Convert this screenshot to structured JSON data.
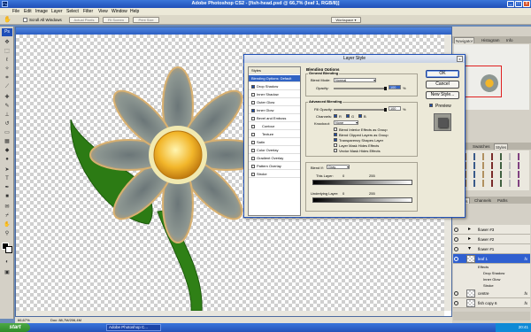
{
  "window": {
    "title": "Adobe Photoshop CS2 - [fish-head.psd @ 66,7% (leaf 1, RGB/8)]",
    "buttons": [
      "_",
      "□",
      "x"
    ]
  },
  "menu": [
    "File",
    "Edit",
    "Image",
    "Layer",
    "Select",
    "Filter",
    "View",
    "Window",
    "Help"
  ],
  "options": {
    "scroll_all": "Scroll All Windows",
    "actual_pixels": "Actual Pixels",
    "fit_screen": "Fit Screen",
    "print_size": "Print Size",
    "workspace": "Workspace"
  },
  "status": {
    "zoom": "66,67%",
    "doc": "Doc: 88,7M/206,4M"
  },
  "dialog": {
    "title": "Layer Style",
    "styles": [
      {
        "label": "Styles",
        "header": true,
        "checked": null
      },
      {
        "label": "Blending Options: Default",
        "selected": true,
        "checked": null
      },
      {
        "label": "Drop Shadow",
        "checked": true
      },
      {
        "label": "Inner Shadow",
        "checked": false
      },
      {
        "label": "Outer Glow",
        "checked": false
      },
      {
        "label": "Inner Glow",
        "checked": true
      },
      {
        "label": "Bevel and Emboss",
        "checked": false
      },
      {
        "label": "Contour",
        "checked": false,
        "indent": true
      },
      {
        "label": "Texture",
        "checked": false,
        "indent": true
      },
      {
        "label": "Satin",
        "checked": false
      },
      {
        "label": "Color Overlay",
        "checked": false
      },
      {
        "label": "Gradient Overlay",
        "checked": false
      },
      {
        "label": "Pattern Overlay",
        "checked": false
      },
      {
        "label": "Stroke",
        "checked": false
      }
    ],
    "blending_options": "Blending Options",
    "general_blending": "General Blending",
    "blend_mode_label": "Blend Mode:",
    "blend_mode": "Normal",
    "opacity_label": "Opacity:",
    "opacity_value": "100",
    "opacity_unit": "%",
    "advanced_blending": "Advanced Blending",
    "fill_opacity_label": "Fill Opacity:",
    "fill_opacity_value": "100",
    "channels_label": "Channels:",
    "channels": [
      "R",
      "G",
      "B"
    ],
    "knockout_label": "Knockout:",
    "knockout": "None",
    "checkboxes": [
      {
        "label": "Blend Interior Effects as Group",
        "checked": false
      },
      {
        "label": "Blend Clipped Layers as Group",
        "checked": true
      },
      {
        "label": "Transparency Shapes Layer",
        "checked": true
      },
      {
        "label": "Layer Mask Hides Effects",
        "checked": false
      },
      {
        "label": "Vector Mask Hides Effects",
        "checked": false
      }
    ],
    "blend_if_label": "Blend If:",
    "blend_if": "Gray",
    "this_layer_label": "This Layer:",
    "this_layer": [
      "0",
      "255"
    ],
    "underlying_label": "Underlying Layer:",
    "underlying": [
      "0",
      "255"
    ],
    "ok": "OK",
    "cancel": "Cancel",
    "new_style": "New Style...",
    "preview": "Preview"
  },
  "panels": {
    "tabs_top": [
      "Navigator",
      "Histogram",
      "Info"
    ],
    "tabs_mid": [
      "Color",
      "Swatches",
      "Styles"
    ],
    "tabs_low": [
      "Layers",
      "Channels",
      "Paths"
    ],
    "layers": [
      {
        "name": "flower #3",
        "kind": "folder"
      },
      {
        "name": "flower #2",
        "kind": "folder"
      },
      {
        "name": "flower #1",
        "kind": "folder"
      },
      {
        "name": "leaf 1",
        "kind": "layer",
        "selected": true,
        "fx": "fx"
      },
      {
        "name": "centre",
        "kind": "layer",
        "fx": "fx"
      },
      {
        "name": "fish copy 6",
        "kind": "layer",
        "fx": "fx"
      }
    ],
    "effects": [
      "Effects",
      "Drop Shadow",
      "Inner Glow",
      "Stroke"
    ]
  },
  "taskbar": {
    "start": "start",
    "item": "Adobe Photoshop C...",
    "clock": "20:41"
  },
  "colors": {
    "accent": "#2f5fd0",
    "titlebar": "#1f4fb8",
    "flower_center": "#f0b020",
    "leaf": "#2a7a12"
  }
}
